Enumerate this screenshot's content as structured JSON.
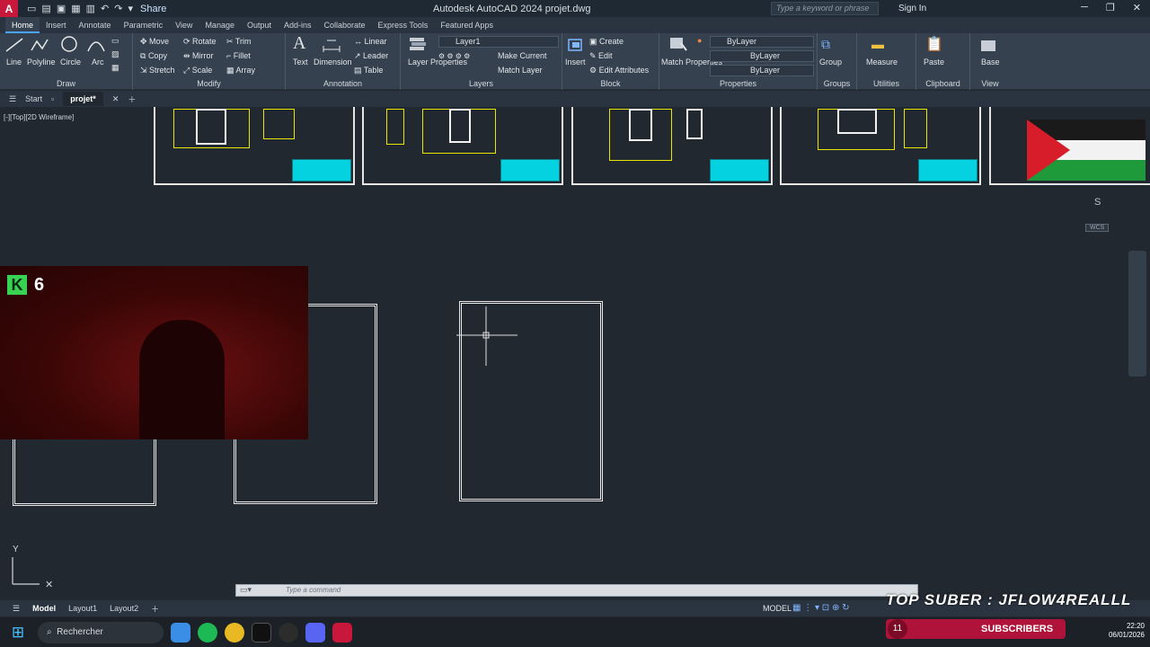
{
  "titlebar": {
    "logo": "A",
    "share": "Share",
    "title": "Autodesk AutoCAD 2024   projet.dwg",
    "search_placeholder": "Type a keyword or phrase",
    "signin": "Sign In"
  },
  "ribbon_tabs": [
    "Home",
    "Insert",
    "Annotate",
    "Parametric",
    "View",
    "Manage",
    "Output",
    "Add-ins",
    "Collaborate",
    "Express Tools",
    "Featured Apps"
  ],
  "draw": {
    "label": "Draw",
    "line": "Line",
    "polyline": "Polyline",
    "circle": "Circle",
    "arc": "Arc"
  },
  "modify": {
    "label": "Modify",
    "move": "Move",
    "rotate": "Rotate",
    "trim": "Trim",
    "copy": "Copy",
    "mirror": "Mirror",
    "fillet": "Fillet",
    "stretch": "Stretch",
    "scale": "Scale",
    "array": "Array"
  },
  "annotation": {
    "label": "Annotation",
    "text": "Text",
    "dimension": "Dimension",
    "linear": "Linear",
    "leader": "Leader",
    "table": "Table"
  },
  "layers": {
    "label": "Layers",
    "layer_properties": "Layer Properties",
    "current_layer": "Layer1",
    "make_current": "Make Current",
    "match_layer": "Match Layer"
  },
  "block": {
    "label": "Block",
    "insert": "Insert",
    "create": "Create",
    "edit": "Edit",
    "edit_attributes": "Edit Attributes"
  },
  "properties": {
    "label": "Properties",
    "match_properties": "Match Properties",
    "color": "ByLayer",
    "linetype": "ByLayer",
    "lineweight": "ByLayer"
  },
  "groups": {
    "label": "Groups",
    "group": "Group"
  },
  "utilities": {
    "label": "Utilities",
    "measure": "Measure"
  },
  "clipboard": {
    "label": "Clipboard",
    "paste": "Paste"
  },
  "view_panel": {
    "label": "View",
    "base": "Base"
  },
  "doctabs": {
    "start": "Start",
    "file": "projet*"
  },
  "canvas": {
    "view_label": "[-][Top][2D Wireframe]",
    "compass": "S",
    "wcs": "WCS"
  },
  "cmdline": {
    "placeholder": "Type  a  command"
  },
  "layout_tabs": [
    "Model",
    "Layout1",
    "Layout2"
  ],
  "status": {
    "model": "MODEL"
  },
  "webcam": {
    "badge": "K",
    "count": "6"
  },
  "overlay": {
    "top_suber": "TOP SUBER : JFLOW4REALLL",
    "subscribers_count": "11",
    "subscribers_label": "SUBSCRIBERS"
  },
  "taskbar": {
    "search": "Rechercher",
    "time": "22:20",
    "date": "06/01/2026"
  }
}
